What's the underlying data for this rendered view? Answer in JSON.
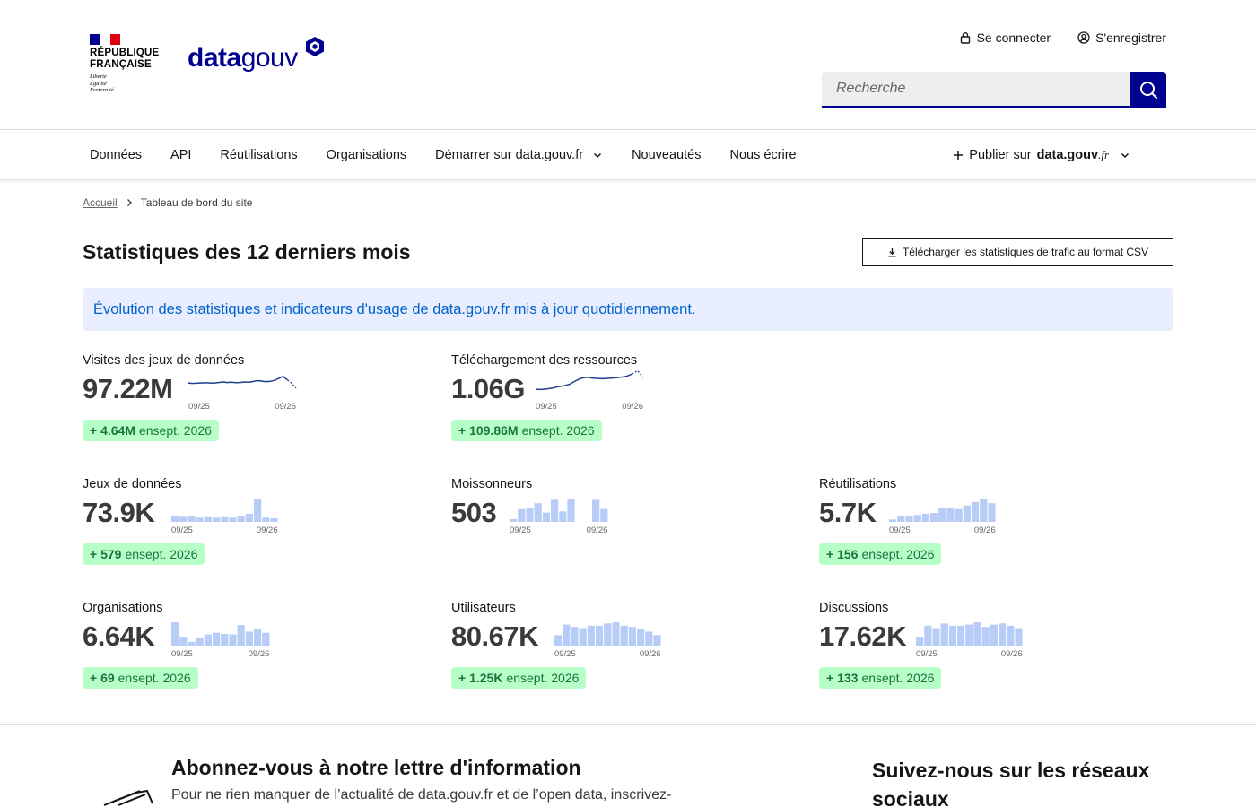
{
  "header": {
    "republique": [
      "RÉPUBLIQUE",
      "FRANÇAISE"
    ],
    "motto": [
      "Liberté",
      "Égalité",
      "Fraternité"
    ],
    "brand_part1": "data",
    "brand_part2": "gouv",
    "login": "Se connecter",
    "register": "S'enregistrer",
    "search_placeholder": "Recherche",
    "colors": {
      "primary": "#000091",
      "flag_blue": "#000091",
      "flag_red": "#e1000f"
    }
  },
  "nav": {
    "items": [
      "Données",
      "API",
      "Réutilisations",
      "Organisations",
      "Démarrer sur data.gouv.fr",
      "Nouveautés",
      "Nous écrire"
    ],
    "publish_prefix": "Publier sur",
    "publish_brand": "data.gouv",
    "publish_suffix": ".fr"
  },
  "breadcrumb": {
    "home": "Accueil",
    "current": "Tableau de bord du site"
  },
  "page": {
    "title": "Statistiques des 12 derniers mois",
    "csv_button": "Télécharger les statistiques de trafic au format CSV",
    "info": "Évolution des statistiques et indicateurs d'usage de data.gouv.fr mis à jour quotidiennement."
  },
  "stats": [
    {
      "label": "Visites des jeux de données",
      "value": "97.22M",
      "delta": "+ 4.64M",
      "delta_suffix": "ensept. 2026",
      "chart": "line",
      "start": "09/25",
      "end": "09/26",
      "series": [
        0.42,
        0.4,
        0.41,
        0.42,
        0.43,
        0.42,
        0.41,
        0.44,
        0.46,
        0.44,
        0.45,
        0.43,
        0.44,
        0.46,
        0.45,
        0.48,
        0.52,
        0.5,
        0.47,
        0.49,
        0.53,
        0.62,
        0.7,
        0.55,
        0.4,
        0.2
      ]
    },
    {
      "label": "Téléchargement des ressources",
      "value": "1.06G",
      "delta": "+ 109.86M",
      "delta_suffix": "ensept. 2026",
      "chart": "line",
      "start": "09/25",
      "end": "09/26",
      "series": [
        0.15,
        0.14,
        0.16,
        0.2,
        0.26,
        0.3,
        0.36,
        0.5,
        0.62,
        0.66,
        0.63,
        0.61,
        0.6,
        0.62,
        0.64,
        0.66,
        0.7,
        0.8,
        0.95,
        0.65
      ]
    },
    {
      "label": "Jeux de données",
      "value": "73.9K",
      "delta": "+ 579",
      "delta_suffix": "ensept. 2026",
      "chart": "bar",
      "start": "09/25",
      "end": "09/26",
      "series": [
        0.25,
        0.22,
        0.24,
        0.18,
        0.2,
        0.18,
        0.2,
        0.18,
        0.24,
        0.35,
        1.0,
        0.18,
        0.15
      ]
    },
    {
      "label": "Moissonneurs",
      "value": "503",
      "delta": "",
      "delta_suffix": "",
      "chart": "bar",
      "start": "09/25",
      "end": "09/26",
      "series": [
        0.12,
        0.55,
        0.6,
        0.8,
        0.4,
        0.95,
        0.45,
        1.0,
        0.0,
        0.0,
        0.95,
        0.55
      ]
    },
    {
      "label": "Réutilisations",
      "value": "5.7K",
      "delta": "+ 156",
      "delta_suffix": "ensept. 2026",
      "chart": "bar",
      "start": "09/25",
      "end": "09/26",
      "series": [
        0.1,
        0.25,
        0.25,
        0.3,
        0.35,
        0.38,
        0.6,
        0.6,
        0.55,
        0.7,
        0.85,
        1.0,
        0.8
      ]
    },
    {
      "label": "Organisations",
      "value": "6.64K",
      "delta": "+ 69",
      "delta_suffix": "ensept. 2026",
      "chart": "bar",
      "start": "09/25",
      "end": "09/26",
      "series": [
        1.0,
        0.38,
        0.16,
        0.35,
        0.48,
        0.55,
        0.5,
        0.48,
        0.88,
        0.6,
        0.7,
        0.55
      ]
    },
    {
      "label": "Utilisateurs",
      "value": "80.67K",
      "delta": "+ 1.25K",
      "delta_suffix": "ensept. 2026",
      "chart": "bar",
      "start": "09/25",
      "end": "09/26",
      "series": [
        0.45,
        0.9,
        0.8,
        0.75,
        0.85,
        0.85,
        0.95,
        1.0,
        0.85,
        0.8,
        0.7,
        0.6,
        0.45
      ]
    },
    {
      "label": "Discussions",
      "value": "17.62K",
      "delta": "+ 133",
      "delta_suffix": "ensept. 2026",
      "chart": "bar",
      "start": "09/25",
      "end": "09/26",
      "series": [
        0.38,
        0.85,
        0.75,
        0.95,
        0.85,
        0.85,
        0.9,
        1.0,
        0.8,
        0.9,
        0.95,
        0.85,
        0.75
      ]
    }
  ],
  "footer": {
    "newsletter_title": "Abonnez-vous à notre lettre d'information",
    "newsletter_text": "Pour ne rien manquer de l’actualité de data.gouv.fr et de l’open data, inscrivez-",
    "social_title": "Suivez-nous sur les réseaux sociaux"
  }
}
